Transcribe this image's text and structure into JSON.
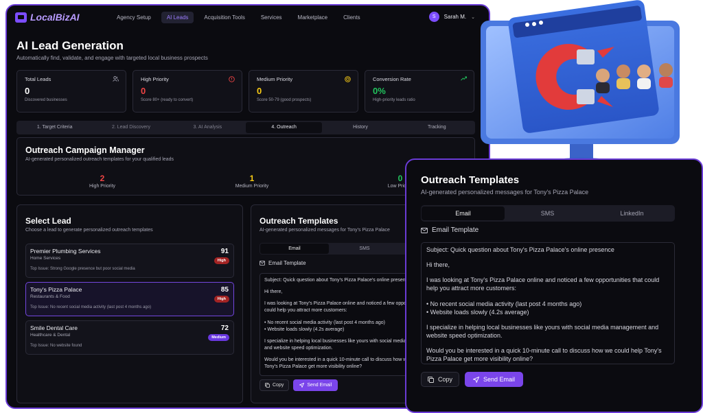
{
  "app": {
    "logo": "LocalBizAI",
    "nav": [
      "Agency Setup",
      "AI Leads",
      "Acquisition Tools",
      "Services",
      "Marketplace",
      "Clients"
    ],
    "active_nav": "AI Leads",
    "user": {
      "initial": "S",
      "name": "Sarah M."
    }
  },
  "page": {
    "title": "AI Lead Generation",
    "subtitle": "Automatically find, validate, and engage with targeted local business prospects"
  },
  "stats": [
    {
      "label": "Total Leads",
      "value": "0",
      "desc": "Discovered businesses",
      "color": "#ffffff",
      "icon": "users-icon"
    },
    {
      "label": "High Priority",
      "value": "0",
      "desc": "Score 80+ (ready to convert)",
      "color": "#ef4444",
      "icon": "alert-icon"
    },
    {
      "label": "Medium Priority",
      "value": "0",
      "desc": "Score 50-79 (good prospects)",
      "color": "#facc15",
      "icon": "target-icon"
    },
    {
      "label": "Conversion Rate",
      "value": "0%",
      "desc": "High-priority leads ratio",
      "color": "#22c55e",
      "icon": "trending-icon"
    }
  ],
  "steps": [
    "1. Target Criteria",
    "2. Lead Discovery",
    "3. AI Analysis",
    "4. Outreach",
    "History",
    "Tracking"
  ],
  "active_step": "4. Outreach",
  "campaign": {
    "title": "Outreach Campaign Manager",
    "subtitle": "AI-generated personalized outreach templates for your qualified leads",
    "counts": [
      {
        "value": "2",
        "label": "High Priority",
        "color": "#ef4444"
      },
      {
        "value": "1",
        "label": "Medium Priority",
        "color": "#facc15"
      },
      {
        "value": "0",
        "label": "Low Priority",
        "color": "#22c55e"
      }
    ]
  },
  "select_lead": {
    "title": "Select Lead",
    "subtitle": "Choose a lead to generate personalized outreach templates",
    "leads": [
      {
        "name": "Premier Plumbing Services",
        "category": "Home Services",
        "issue": "Top Issue: Strong Google presence but poor social media",
        "score": "91",
        "badge": "High"
      },
      {
        "name": "Tony's Pizza Palace",
        "category": "Restaurants & Food",
        "issue": "Top Issue: No recent social media activity (last post 4 months ago)",
        "score": "85",
        "badge": "High"
      },
      {
        "name": "Smile Dental Care",
        "category": "Healthcare & Dental",
        "issue": "Top Issue: No website found",
        "score": "72",
        "badge": "Medium"
      }
    ]
  },
  "templates": {
    "title": "Outreach Templates",
    "subtitle": "AI-generated personalized messages for Tony's Pizza Palace",
    "tabs": [
      "Email",
      "SMS",
      "LinkedIn"
    ],
    "email_title": "Email Template",
    "small_lines": [
      "Subject: Quick question about Tony's Pizza Palace's online presence",
      "Hi there,",
      "I was looking at Tony's Pizza Palace online and noticed a few opportunities that",
      "could help you attract more customers:",
      "• No recent social media activity (last post 4 months ago)",
      "• Website loads slowly (4.2s average)",
      "I specialize in helping local businesses like yours with social media management",
      "and website speed optimization.",
      "Would you be interested in a quick 10-minute call to discuss how we could help",
      "Tony's Pizza Palace get more visibility online?"
    ],
    "zoom_paragraphs": [
      "Subject: Quick question about Tony's Pizza Palace's online presence",
      "Hi there,",
      "I was looking at Tony's Pizza Palace online and noticed a few opportunities that could help you attract more customers:",
      "• No recent social media activity (last post 4 months ago)\n• Website loads slowly (4.2s average)",
      "I specialize in helping local businesses like yours with social media management and website speed optimization.",
      "Would you be interested in a quick 10-minute call to discuss how we could help Tony's Pizza Palace get more visibility online?"
    ],
    "copy_label": "Copy",
    "send_label": "Send Email"
  }
}
